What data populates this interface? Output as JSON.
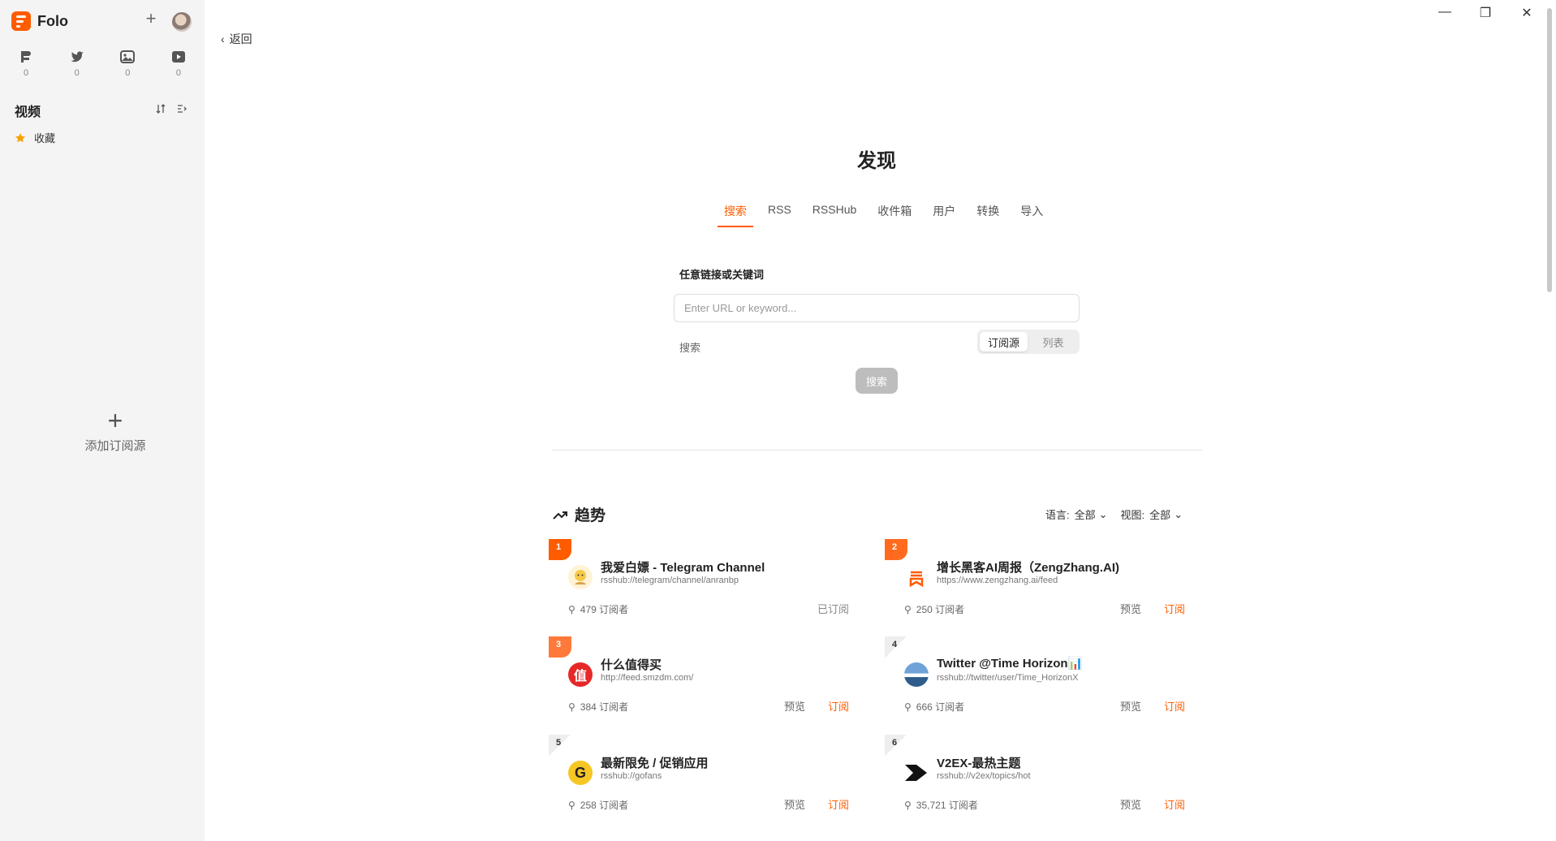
{
  "app": {
    "name": "Folo"
  },
  "views": [
    {
      "icon": "article-icon",
      "count": "0"
    },
    {
      "icon": "twitter-icon",
      "count": "0"
    },
    {
      "icon": "image-icon",
      "count": "0"
    },
    {
      "icon": "video-icon",
      "count": "0"
    }
  ],
  "sidebar": {
    "section_title": "视频",
    "favorites_label": "收藏",
    "add_subscription_label": "添加订阅源"
  },
  "nav": {
    "back_label": "返回"
  },
  "page": {
    "title": "发现",
    "tabs": [
      {
        "label": "搜索",
        "active": true
      },
      {
        "label": "RSS"
      },
      {
        "label": "RSSHub"
      },
      {
        "label": "收件箱"
      },
      {
        "label": "用户"
      },
      {
        "label": "转换"
      },
      {
        "label": "导入"
      }
    ],
    "form_label": "任意链接或关键词",
    "input_placeholder": "Enter URL or keyword...",
    "hint_label": "搜索",
    "segment": [
      {
        "label": "订阅源",
        "active": true
      },
      {
        "label": "列表"
      }
    ],
    "search_button": "搜索"
  },
  "trending": {
    "title": "趋势",
    "language_label": "语言:",
    "language_value": "全部",
    "view_label": "视图:",
    "view_value": "全部",
    "preview_label": "预览",
    "subscribe_label": "订阅",
    "subscribed_label": "已订阅",
    "items": [
      {
        "rank": "1",
        "title": "我爱白嫖 - Telegram Channel",
        "url": "rsshub://telegram/channel/anranbp",
        "subscribers": "479 订阅者",
        "status": "已订阅"
      },
      {
        "rank": "2",
        "title": "增长黑客AI周报（ZengZhang.AI)",
        "url": "https://www.zengzhang.ai/feed",
        "subscribers": "250 订阅者",
        "status": "订阅"
      },
      {
        "rank": "3",
        "title": "什么值得买",
        "url": "http://feed.smzdm.com/",
        "subscribers": "384 订阅者",
        "status": "订阅"
      },
      {
        "rank": "4",
        "title": "Twitter @Time Horizon📊",
        "url": "rsshub://twitter/user/Time_HorizonX",
        "subscribers": "666 订阅者",
        "status": "订阅"
      },
      {
        "rank": "5",
        "title": "最新限免 / 促销应用",
        "url": "rsshub://gofans",
        "subscribers": "258 订阅者",
        "status": "订阅"
      },
      {
        "rank": "6",
        "title": "V2EX-最热主题",
        "url": "rsshub://v2ex/topics/hot",
        "subscribers": "35,721 订阅者",
        "status": "订阅"
      }
    ]
  },
  "colors": {
    "accent": "#ff5c00",
    "sidebar_bg": "#f4f4f5"
  }
}
